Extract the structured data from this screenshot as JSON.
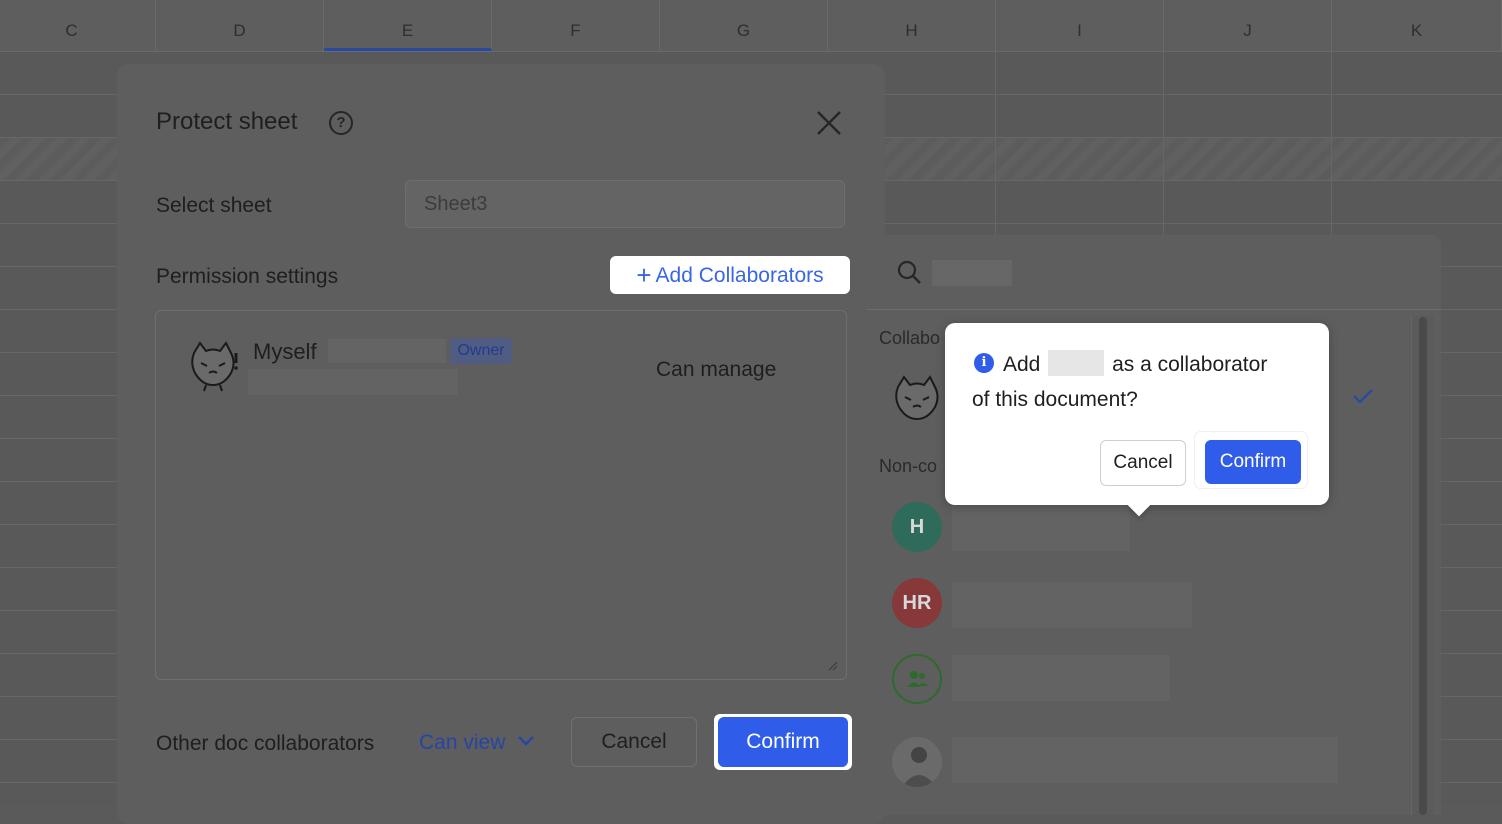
{
  "spreadsheet": {
    "columns": [
      "C",
      "D",
      "E",
      "F",
      "G",
      "H",
      "I",
      "J",
      "K"
    ],
    "active_column": "E"
  },
  "dialog": {
    "title": "Protect sheet",
    "help_icon": "question-circle-icon",
    "close_icon": "close-icon",
    "select_sheet_label": "Select sheet",
    "select_sheet_value": "Sheet3",
    "permission_settings_label": "Permission settings",
    "add_collaborators_label": "Add Collaborators",
    "owner_name": "Myself",
    "owner_badge": "Owner",
    "owner_permission": "Can manage",
    "other_collaborators_label": "Other doc collaborators",
    "other_collaborators_value": "Can view",
    "cancel_label": "Cancel",
    "confirm_label": "Confirm"
  },
  "panel": {
    "section_collaborators": "Collabo",
    "section_non_collaborators": "Non-co",
    "avatars": [
      "H",
      "HR"
    ]
  },
  "popover": {
    "message_part1": "Add",
    "message_part2": "as a collaborator",
    "message_part3": "of this document?",
    "cancel_label": "Cancel",
    "confirm_label": "Confirm"
  },
  "colors": {
    "accent": "#2f5de9",
    "overlay": "#595959"
  }
}
